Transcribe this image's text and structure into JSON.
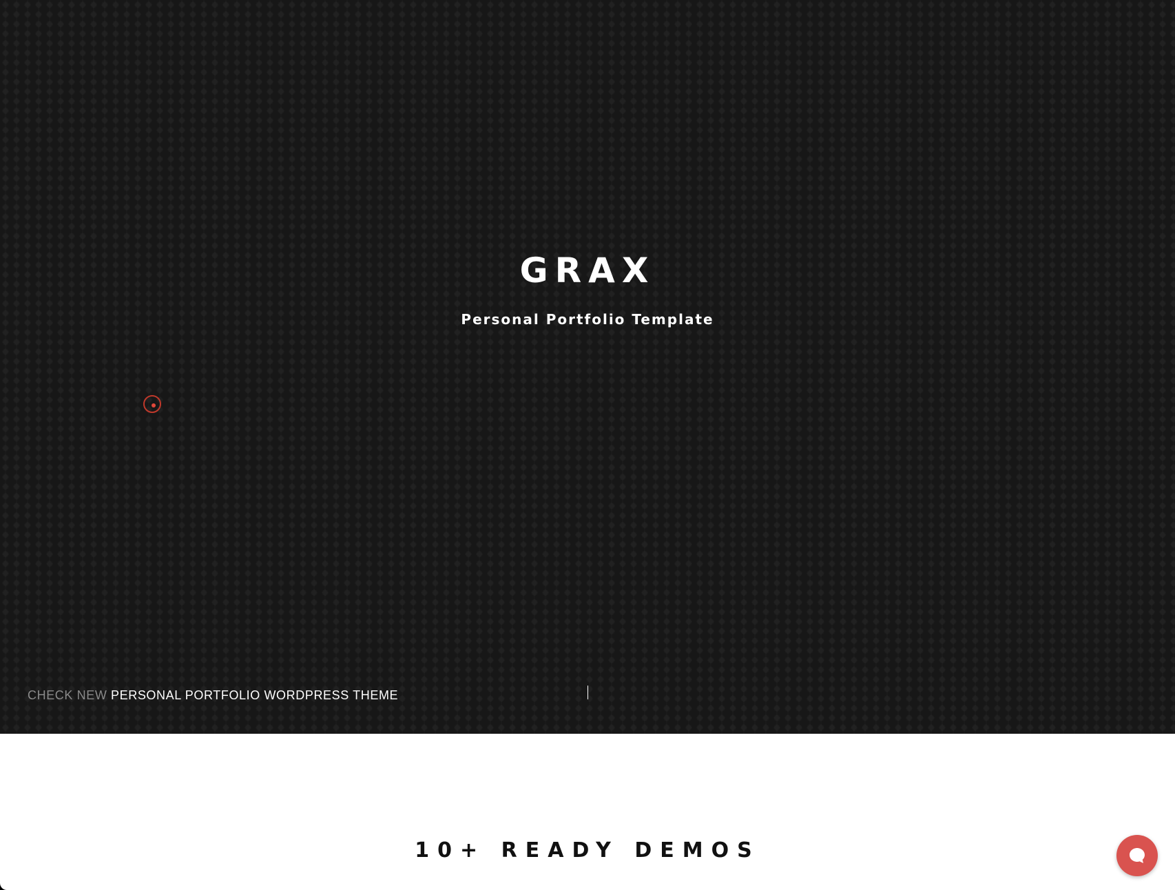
{
  "hero": {
    "title": "GRAX",
    "subtitle": "Personal Portfolio Template"
  },
  "promo": {
    "prefix": "CHECK NEW",
    "link_text": "PERSONAL PORTFOLIO WORDPRESS THEME"
  },
  "demos": {
    "title": "10+ READY DEMOS"
  },
  "icons": {
    "cursor": "cursor-ring-icon",
    "chat": "chat-bubble-icon",
    "scroll": "scroll-indicator-line"
  },
  "colors": {
    "hero_background": "#1c1c1c",
    "accent": "#d9534f",
    "text_light": "#ffffff",
    "text_muted": "#8a8a8a",
    "text_dark": "#111111"
  }
}
